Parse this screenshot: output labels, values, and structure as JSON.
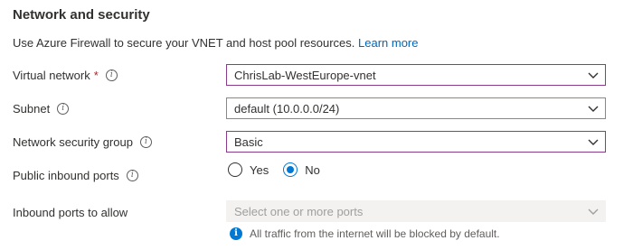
{
  "section": {
    "title": "Network and security",
    "description": "Use Azure Firewall to secure your VNET and host pool resources.",
    "learn_more": "Learn more"
  },
  "fields": {
    "virtual_network": {
      "label": "Virtual network",
      "required_mark": "*",
      "value": "ChrisLab-WestEurope-vnet"
    },
    "subnet": {
      "label": "Subnet",
      "value": "default (10.0.0.0/24)"
    },
    "nsg": {
      "label": "Network security group",
      "value": "Basic"
    },
    "public_inbound": {
      "label": "Public inbound ports",
      "options": [
        "Yes",
        "No"
      ],
      "selected": "No"
    },
    "inbound_allow": {
      "label": "Inbound ports to allow",
      "placeholder": "Select one or more ports",
      "note": "All traffic from the internet will be blocked by default."
    }
  },
  "icons": {
    "info": "info-icon",
    "chevron": "chevron-down-icon",
    "note": "info-filled-icon"
  },
  "colors": {
    "link": "#0067b8",
    "focus_border": "#8a3c8c",
    "radio_selected": "#0078d4",
    "required": "#a4262c"
  }
}
